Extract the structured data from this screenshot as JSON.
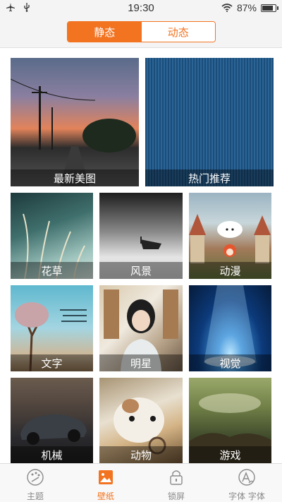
{
  "status": {
    "time": "19:30",
    "battery": "87%",
    "battery_level": 0.87
  },
  "segmented": {
    "options": [
      "静态",
      "动态"
    ],
    "active_index": 0
  },
  "tiles": [
    {
      "label": "最新美图"
    },
    {
      "label": "热门推荐"
    },
    {
      "label": "花草"
    },
    {
      "label": "风景"
    },
    {
      "label": "动漫"
    },
    {
      "label": "文字"
    },
    {
      "label": "明星"
    },
    {
      "label": "视觉"
    },
    {
      "label": "机械"
    },
    {
      "label": "动物"
    },
    {
      "label": "游戏"
    }
  ],
  "tabbar": {
    "items": [
      {
        "label": "主题",
        "icon": "palette-icon"
      },
      {
        "label": "壁纸",
        "icon": "wallpaper-icon"
      },
      {
        "label": "锁屏",
        "icon": "lock-icon"
      },
      {
        "label": "字体 字体",
        "icon": "font-icon"
      }
    ],
    "active_index": 1
  },
  "colors": {
    "accent": "#f27320",
    "inactive": "#8a8a8a"
  }
}
